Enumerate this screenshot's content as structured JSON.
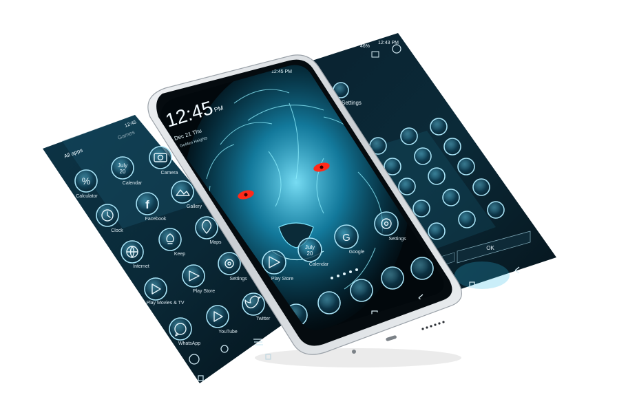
{
  "left_screen": {
    "status_time": "12:45",
    "tab_all_apps": "All apps",
    "tab_games": "Games",
    "apps": [
      {
        "label": "Calculator",
        "icon": "percent-icon"
      },
      {
        "label": "Calendar",
        "icon": "calendar-icon",
        "text": "July 20"
      },
      {
        "label": "Camera",
        "icon": "camera-icon"
      },
      {
        "label": "Clock",
        "icon": "clock-icon"
      },
      {
        "label": "Facebook",
        "icon": "facebook-icon"
      },
      {
        "label": "Gallery",
        "icon": "gallery-icon"
      },
      {
        "label": "Internet",
        "icon": "globe-icon"
      },
      {
        "label": "Keep",
        "icon": "keep-icon"
      },
      {
        "label": "Maps",
        "icon": "map-pin-icon"
      },
      {
        "label": "Play Movies & TV",
        "icon": "movie-icon"
      },
      {
        "label": "Play Store",
        "icon": "play-store-icon"
      },
      {
        "label": "Settings",
        "icon": "gear-icon"
      },
      {
        "label": "WhatsApp",
        "icon": "whatsapp-icon"
      },
      {
        "label": "YouTube",
        "icon": "youtube-icon"
      },
      {
        "label": "Twitter",
        "icon": "twitter-icon"
      }
    ]
  },
  "center_phone": {
    "status_time": "12:45 PM",
    "clock_time": "12:45",
    "clock_ampm": "PM",
    "date": "Dec 21 Thu",
    "location": "Golden Heights",
    "dock_apps": [
      {
        "label": "Calendar",
        "icon": "calendar-icon",
        "text": "July 20"
      },
      {
        "label": "Google",
        "icon": "google-icon"
      },
      {
        "label": "Settings",
        "icon": "gear-icon"
      },
      {
        "label": "Play Store",
        "icon": "play-store-icon"
      }
    ],
    "wallpaper": "blue-lion-red-eyes"
  },
  "right_screen": {
    "status_time": "12:43 PM",
    "status_battery": "46%",
    "title": "Settings",
    "dialog_button": "OK"
  },
  "colors": {
    "screen_bg": "#071a24",
    "glow": "#2ad2ff",
    "eye": "#ff2a1a",
    "icon_stroke": "#a9e4f7"
  }
}
